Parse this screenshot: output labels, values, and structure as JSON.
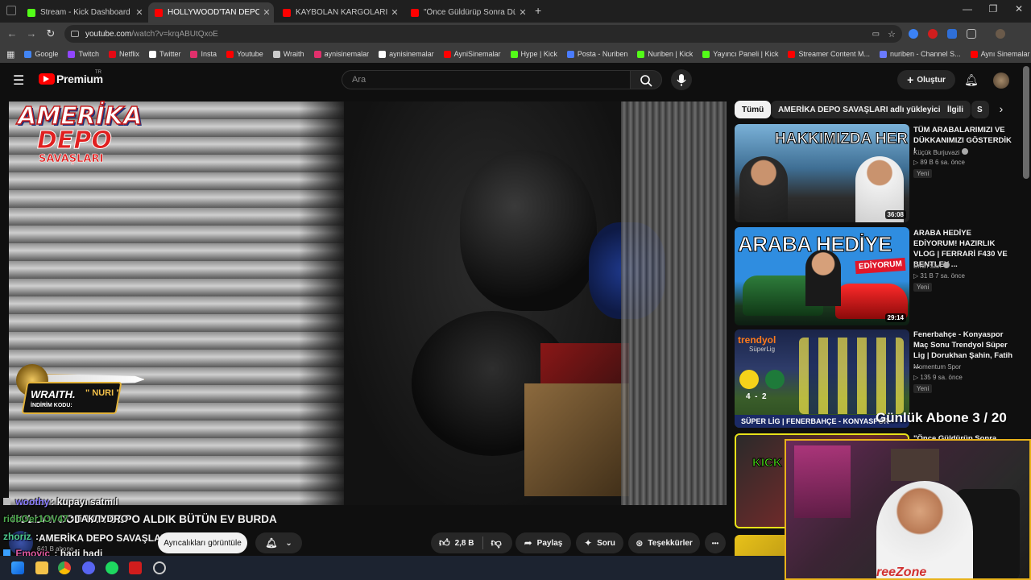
{
  "browser": {
    "tabs": [
      {
        "title": "Stream - Kick Dashboard",
        "active": false,
        "favicon_color": "#53fc18"
      },
      {
        "title": "HOLLYWOOD'TAN DEPO ALDIK",
        "active": true,
        "favicon_color": "#ff0000"
      },
      {
        "title": "KAYBOLAN KARGOLARI SATIN",
        "active": false,
        "favicon_color": "#ff0000"
      },
      {
        "title": "\"Önce Güldürüp Sonra Düşündü",
        "active": false,
        "favicon_color": "#ff0000"
      }
    ],
    "new_tab": "+",
    "close_glyph": "✕",
    "window_controls": {
      "minimize": "—",
      "maximize": "❐",
      "close": "✕"
    },
    "url_host": "youtube.com",
    "url_path": "/watch?v=krqABUtQxoE",
    "bookmarks": [
      {
        "label": "Google",
        "color": "#4285f4"
      },
      {
        "label": "Twitch",
        "color": "#9146ff"
      },
      {
        "label": "Netflix",
        "color": "#e50914"
      },
      {
        "label": "Twitter",
        "color": "#ffffff"
      },
      {
        "label": "Insta",
        "color": "#e1306c"
      },
      {
        "label": "Youtube",
        "color": "#ff0000"
      },
      {
        "label": "Wraith",
        "color": "#cccccc"
      },
      {
        "label": "aynisinemalar",
        "color": "#e1306c"
      },
      {
        "label": "aynisinemalar",
        "color": "#ffffff"
      },
      {
        "label": "AyniSinemalar",
        "color": "#ff0000"
      },
      {
        "label": "Hype | Kick",
        "color": "#53fc18"
      },
      {
        "label": "Posta - Nuriben",
        "color": "#4a7cff"
      },
      {
        "label": "Nuriben | Kick",
        "color": "#53fc18"
      },
      {
        "label": "Yayıncı Paneli | Kick",
        "color": "#53fc18"
      },
      {
        "label": "Streamer Content M...",
        "color": "#ff0000"
      },
      {
        "label": "nuriben - Channel S...",
        "color": "#6a7aff"
      },
      {
        "label": "Aynı Sinemalar - Ça...",
        "color": "#ff0000"
      }
    ]
  },
  "youtube": {
    "logo": "Premium",
    "logo_sup": "TR",
    "search_placeholder": "Ara",
    "create_label": "Oluştur",
    "video_title": "HOLLYWOOD'TAN DEPO ALDIK BÜTÜN EV BURDA",
    "channel_name": "AMERİKA DEPO SAVAŞLARI",
    "channel_subs": "641 B abone",
    "members_label": "Ayrıcalıkları görüntüle",
    "likes": "2,8 B",
    "share_label": "Paylaş",
    "ask_label": "Soru",
    "thanks_label": "Teşekkürler",
    "more_glyph": "•••"
  },
  "overlay": {
    "logo_line1": "AMERİKA",
    "logo_line2": "DEPO",
    "logo_line3": "SAVAŞLARI",
    "sponsor_name": "WRAITH.",
    "sponsor_code_label": "İNDİRİM KODU:",
    "sponsor_code": "\" NURI \""
  },
  "chat": [
    {
      "user": "woothy",
      "text": " kupayı satmıl",
      "color": "#8a7dff"
    },
    {
      "user": "ridbOer1OV47",
      "text": " ТАКЛУDRO",
      "color": "#4ea94e"
    },
    {
      "user": "zhoriz",
      "text": " :",
      "color": "#4ec98e"
    },
    {
      "user": "Emovic",
      "text": " : hadi hadi",
      "color": "#e05aa0"
    }
  ],
  "sidebar": {
    "chips": [
      "Tümü",
      "AMERİKA DEPO SAVAŞLARI adlı yükleyiciden",
      "İlgili",
      "S"
    ],
    "recs": [
      {
        "title": "TÜM ARABALARIMIZI VE DÜKKANIMIZI GÖSTERDİK !",
        "channel": "Küçük Burjuvazi",
        "verified": true,
        "meta": "▷ 89 B   6 sa. önce",
        "new": "Yeni",
        "duration": "36:08",
        "thumb_text": "HAKKIMIZDA HER ŞEY!"
      },
      {
        "title": "ARABA HEDİYE EDİYORUM! HAZIRLIK VLOG | FERRARİ F430 VE BENTLEY ...",
        "channel": "Emin San",
        "verified": true,
        "meta": "▷ 31 B   7 sa. önce",
        "new": "Yeni",
        "duration": "29:14",
        "thumb_text": "ARABA HEDİYE"
      },
      {
        "title": "Fenerbahçe - Konyaspor Maç Sonu Trendyol Süper Lig | Dorukhan Şahin, Fatih ...",
        "channel": "Momentum Spor",
        "verified": false,
        "meta": "▷ 135   9 sa. önce",
        "new": "Yeni",
        "duration": "",
        "thumb_text": "SÜPER LİG | FENERBAHÇE - KONYASPOR"
      },
      {
        "title": "\"Önce Güldürüp Sonra",
        "channel": "",
        "verified": false,
        "meta": "",
        "new": "",
        "duration": "",
        "thumb_text": "KICK"
      }
    ],
    "thumb_brand": "trendyol",
    "thumb_brand_sub": "SüperLig",
    "thumb_score": "4  -  2"
  },
  "stream": {
    "sub_counter": "Günlük Abone 3 / 20",
    "shirt_brand": "reeZone"
  }
}
